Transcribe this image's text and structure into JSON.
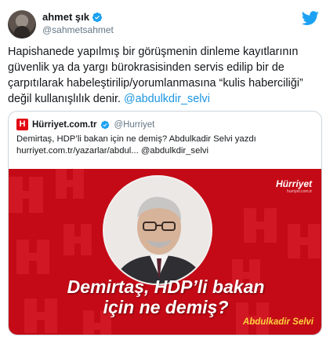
{
  "tweet": {
    "display_name": "ahmet şık",
    "handle": "@sahmetsahmet",
    "text_main": "Hapishanede yapılmış bir görüşmenin dinleme kayıtlarının güvenlik ya da yargı bürokrasisinden servis edilip bir de çarpıtılarak habeleştirilip/yorumlanmasına “kulis haberciliği” değil kullanışlılık  denir.",
    "mention": "@abdulkdir_selvi"
  },
  "quote": {
    "logo_letter": "H",
    "name": "Hürriyet.com.tr",
    "handle": "@Hurriyet",
    "line1": "Demirtaş, HDP’li bakan için ne demiş? Abdulkadir Selvi yazdı",
    "line2": "hurriyet.com.tr/yazarlar/abdul... @abdulkdir_selvi"
  },
  "media": {
    "brand": "Hürriyet",
    "brand_sub": "hurriyet.com.tr",
    "headline_line1": "Demirtaş, HDP’li bakan",
    "headline_line2": "için ne demiş?",
    "author": "Abdulkadir Selvi"
  },
  "colors": {
    "accent": "#1b95e0",
    "brand_red": "#c40a16",
    "author_yellow": "#ffd23f"
  },
  "icons": {
    "verified": "verified-badge-icon",
    "platform": "twitter-bird-icon"
  }
}
